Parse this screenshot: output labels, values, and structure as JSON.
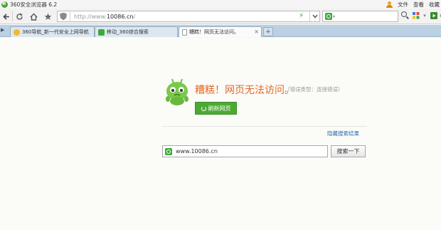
{
  "window": {
    "title": "360安全浏览器 6.2",
    "menu": [
      "文件",
      "查看",
      "收藏"
    ]
  },
  "toolbar": {
    "url_prefix": "http://www.",
    "url_domain": "10086.cn",
    "url_suffix": "/",
    "search_engine_icon": "search-engine-icon",
    "colors": {
      "bolt": "#3aa835",
      "accent_green": "#4caa34"
    }
  },
  "tabs": [
    {
      "label": "360导航_新一代安全上网导航",
      "active": false,
      "icon": "360-nav-icon"
    },
    {
      "label": "移动_360综合搜索",
      "active": false,
      "icon": "360-search-icon"
    },
    {
      "label": "糟糕！网页无法访问。",
      "active": true,
      "icon": "page-icon"
    }
  ],
  "error": {
    "title": "糟糕！网页无法访问。",
    "type_text": "（错误类型：连接错误）",
    "refresh_label": "刷新网页",
    "hide_results_label": "隐藏搜索结果",
    "search_value": "www.10086.cn",
    "search_button_label": "搜索一下",
    "colors": {
      "title": "#e36a22",
      "link": "#2f6fb1"
    }
  }
}
